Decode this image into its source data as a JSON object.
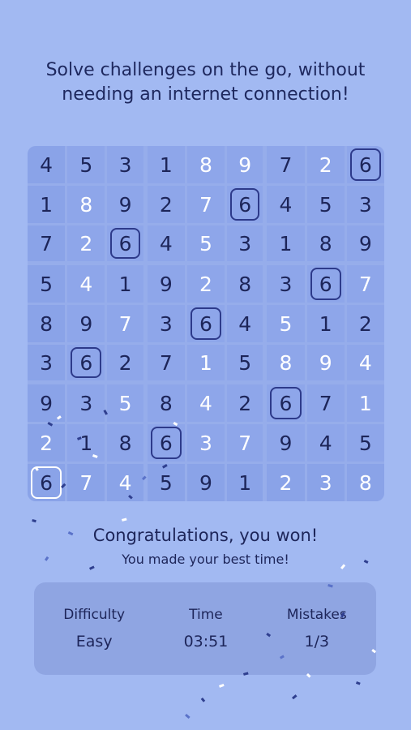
{
  "tagline": "Solve challenges on the go, without needing an internet connection!",
  "board": {
    "rows": [
      [
        "4",
        "5",
        "3",
        "1",
        "8",
        "9",
        "7",
        "2",
        "6"
      ],
      [
        "1",
        "8",
        "9",
        "2",
        "7",
        "6",
        "4",
        "5",
        "3"
      ],
      [
        "7",
        "2",
        "6",
        "4",
        "5",
        "3",
        "1",
        "8",
        "9"
      ],
      [
        "5",
        "4",
        "1",
        "9",
        "2",
        "8",
        "3",
        "6",
        "7"
      ],
      [
        "8",
        "9",
        "7",
        "3",
        "6",
        "4",
        "5",
        "1",
        "2"
      ],
      [
        "3",
        "6",
        "2",
        "7",
        "1",
        "5",
        "8",
        "9",
        "4"
      ],
      [
        "9",
        "3",
        "5",
        "8",
        "4",
        "2",
        "6",
        "7",
        "1"
      ],
      [
        "2",
        "1",
        "8",
        "6",
        "3",
        "7",
        "9",
        "4",
        "5"
      ],
      [
        "6",
        "7",
        "4",
        "5",
        "9",
        "1",
        "2",
        "3",
        "8"
      ]
    ],
    "light_cells": [
      "0-4",
      "0-5",
      "0-7",
      "1-1",
      "1-4",
      "2-1",
      "2-4",
      "3-1",
      "3-4",
      "3-8",
      "4-2",
      "4-6",
      "5-4",
      "5-6",
      "5-7",
      "5-8",
      "6-2",
      "6-4",
      "6-8",
      "7-0",
      "7-4",
      "7-5",
      "8-1",
      "8-2",
      "8-6",
      "8-7",
      "8-8"
    ],
    "highlighted_cells": [
      "0-8",
      "1-5",
      "2-2",
      "3-7",
      "4-4",
      "5-1",
      "6-6",
      "7-3",
      "8-0"
    ],
    "colors": {
      "cell": "#8ea6ea",
      "highlight_border": "#2d3a8a",
      "dark_digit": "#1d2559",
      "light_digit": "#ffffff"
    }
  },
  "result": {
    "title": "Congratulations, you won!",
    "subtitle": "You made your best time!"
  },
  "stats": [
    {
      "label": "Difficulty",
      "value": "Easy"
    },
    {
      "label": "Time",
      "value": "03:51"
    },
    {
      "label": "Mistakes",
      "value": "1/3"
    }
  ]
}
